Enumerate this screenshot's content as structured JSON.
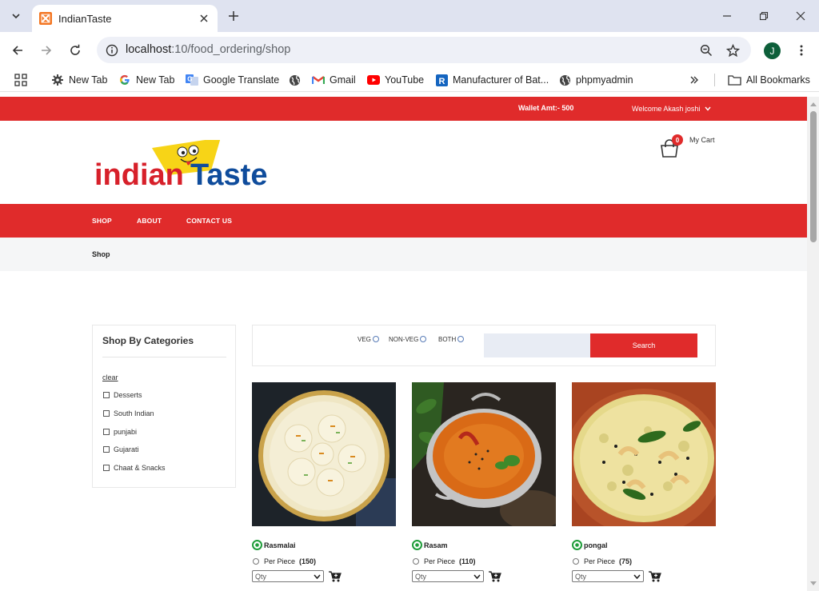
{
  "browser": {
    "tab_title": "IndianTaste",
    "url_host": "localhost",
    "url_path": ":10/food_ordering/shop",
    "profile_initial": "J",
    "bookmarks": [
      {
        "label": "New Tab",
        "icon": "gear-icon"
      },
      {
        "label": "New Tab",
        "icon": "google-icon"
      },
      {
        "label": "Google Translate",
        "icon": "translate-icon"
      },
      {
        "label": "",
        "icon": "globe-icon"
      },
      {
        "label": "Gmail",
        "icon": "gmail-icon"
      },
      {
        "label": "YouTube",
        "icon": "youtube-icon"
      },
      {
        "label": "Manufacturer of Bat...",
        "icon": "r-icon"
      },
      {
        "label": "phpmyadmin",
        "icon": "globe-icon"
      }
    ],
    "all_bookmarks": "All Bookmarks"
  },
  "topbar": {
    "wallet": "Wallet Amt:- 500",
    "welcome": "Welcome Akash joshi"
  },
  "header": {
    "logo_text_1": "indian",
    "logo_text_2": "Taste",
    "cart_count": "0",
    "cart_label": "My Cart"
  },
  "nav": {
    "shop": "SHOP",
    "about": "ABOUT",
    "contact": "CONTACT US"
  },
  "breadcrumb": "Shop",
  "sidebar": {
    "title": "Shop By Categories",
    "clear": "clear",
    "categories": [
      "Desserts",
      "South Indian",
      "punjabi",
      "Gujarati",
      "Chaat & Snacks"
    ]
  },
  "filter": {
    "veg": "VEG",
    "nonveg": "NON-VEG",
    "both": "BOTH",
    "search_button": "Search",
    "search_placeholder": ""
  },
  "products": [
    {
      "name": "Rasmalai",
      "unit": "Per Piece",
      "price": "(150)",
      "qty_placeholder": "Qty"
    },
    {
      "name": "Rasam",
      "unit": "Per Piece",
      "price": "(110)",
      "qty_placeholder": "Qty"
    },
    {
      "name": "pongal",
      "unit": "Per Piece",
      "price": "(75)",
      "qty_placeholder": "Qty"
    }
  ],
  "colors": {
    "brand_red": "#e02b2b",
    "logo_blue": "#0f4c9c",
    "veg_green": "#1f9d3a"
  }
}
